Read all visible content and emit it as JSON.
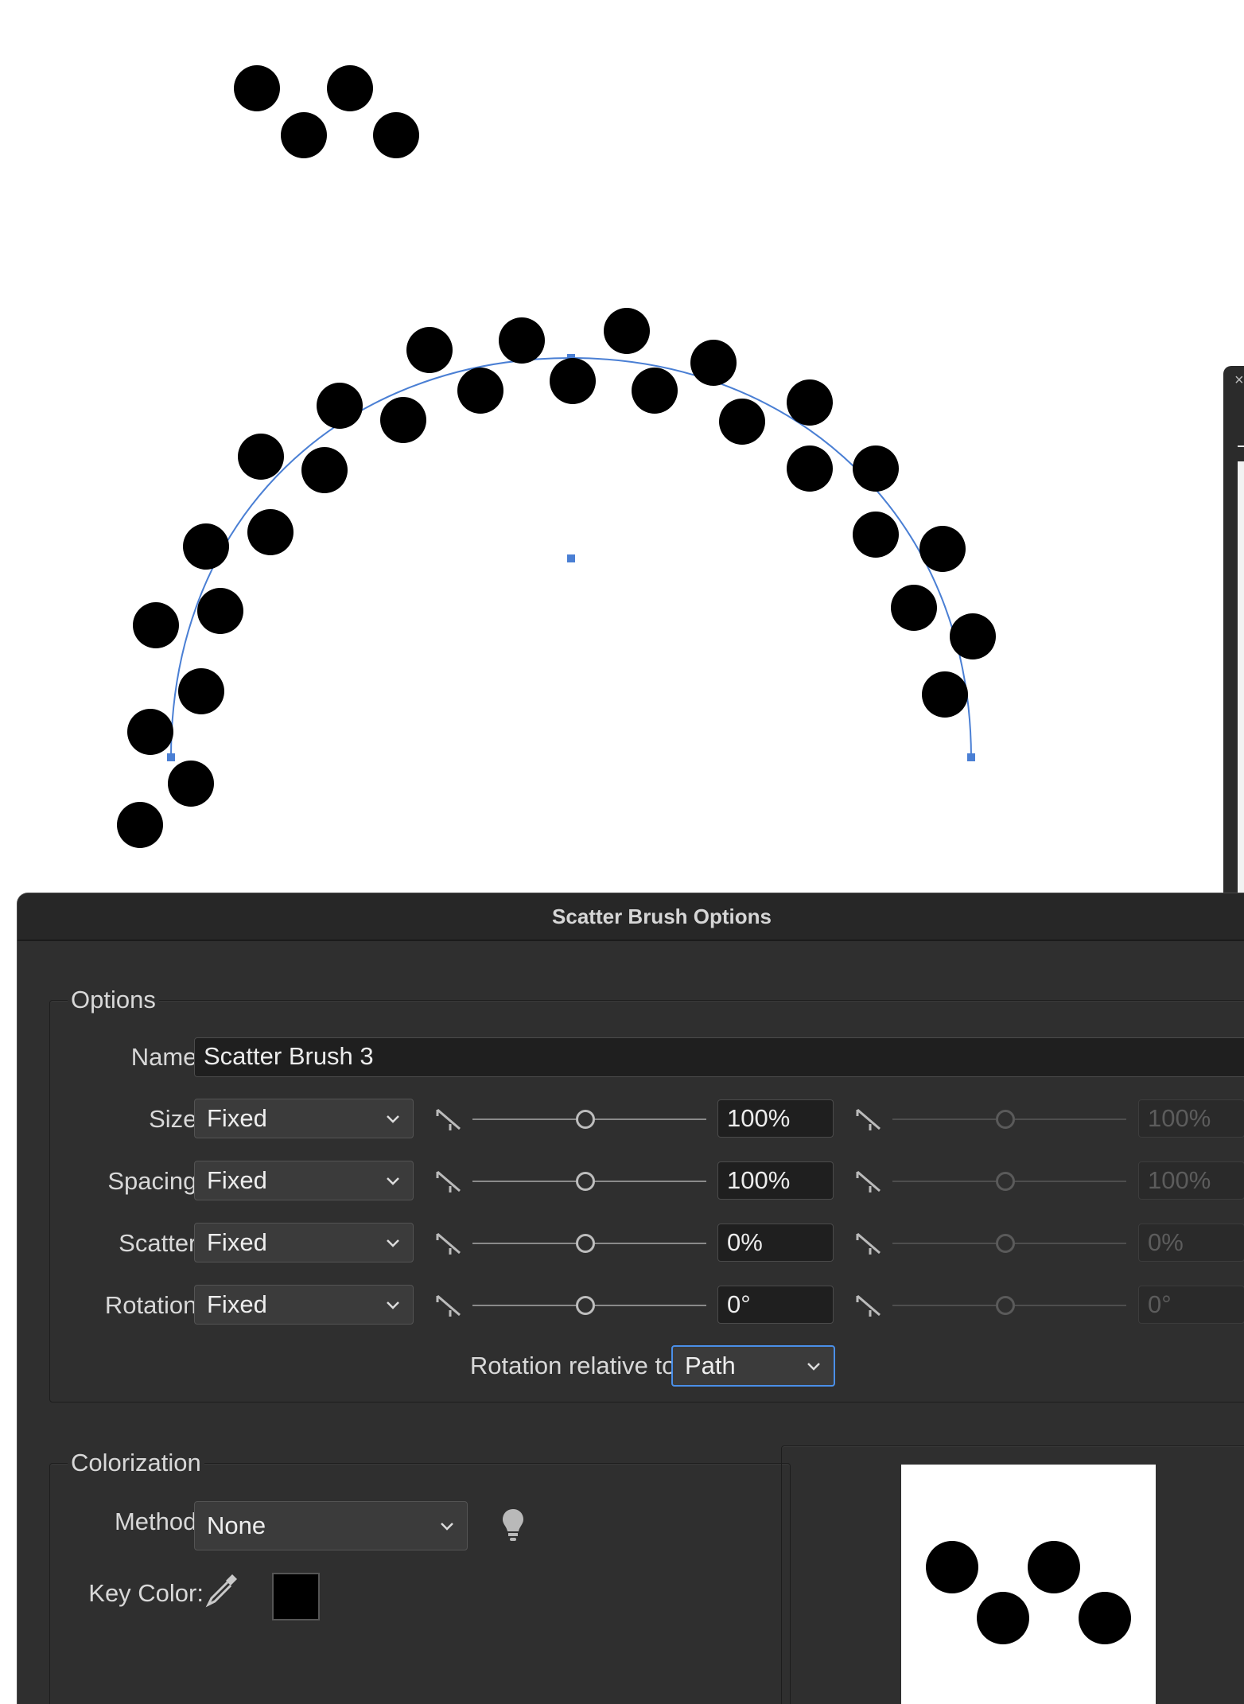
{
  "dialog": {
    "title": "Scatter Brush Options",
    "options_group_label": "Options",
    "name_label": "Name:",
    "name_value": "Scatter Brush 3",
    "rows": [
      {
        "label": "Size:",
        "mode": "Fixed",
        "value": "100%",
        "max_value": "100%"
      },
      {
        "label": "Spacing:",
        "mode": "Fixed",
        "value": "100%",
        "max_value": "100%"
      },
      {
        "label": "Scatter:",
        "mode": "Fixed",
        "value": "0%",
        "max_value": "0%"
      },
      {
        "label": "Rotation:",
        "mode": "Fixed",
        "value": "0°",
        "max_value": "0°"
      }
    ],
    "rotation_relative_label": "Rotation relative to:",
    "rotation_relative_value": "Path",
    "colorization_group_label": "Colorization",
    "method_label": "Method:",
    "method_value": "None",
    "key_color_label": "Key Color:",
    "key_color": "#000000"
  },
  "colors": {
    "dialog_bg": "#2f2f2f",
    "path_stroke": "#4a7fd4",
    "focus_ring": "#4a8fe8"
  },
  "icons": [
    "pressure-slider-icon",
    "chevron-down-icon",
    "lightbulb-icon",
    "eyedropper-icon",
    "close-icon"
  ]
}
